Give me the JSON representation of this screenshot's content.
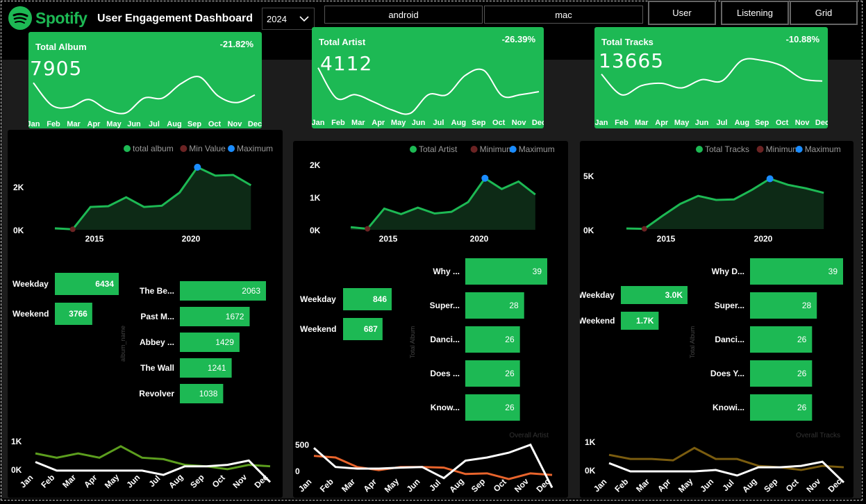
{
  "header": {
    "logo_text": "Spotify",
    "title": "User Engagement Dashboard",
    "year": "2024",
    "platforms": [
      "android",
      "mac"
    ],
    "nav": [
      "User",
      "Listening",
      "Grid"
    ]
  },
  "colors": {
    "brand": "#1DB954",
    "min": "#6b2323",
    "max": "#1a8cff"
  },
  "months": [
    "Jan",
    "Feb",
    "Mar",
    "Apr",
    "May",
    "Jun",
    "Jul",
    "Aug",
    "Sep",
    "Oct",
    "Nov",
    "Dec"
  ],
  "kpis": [
    {
      "label": "Total Album",
      "value": "7905",
      "pct": "-21.82%",
      "trend": [
        0.72,
        0.22,
        0.18,
        0.35,
        0.12,
        0.05,
        0.38,
        0.38,
        0.7,
        0.85,
        0.43,
        0.28,
        0.45
      ]
    },
    {
      "label": "Total Artist",
      "value": "4112",
      "pct": "-26.39%",
      "trend": [
        0.95,
        0.35,
        0.42,
        0.28,
        0.12,
        0.05,
        0.42,
        0.42,
        0.8,
        0.9,
        0.4,
        0.42,
        0.48
      ]
    },
    {
      "label": "Total Tracks",
      "value": "13665",
      "pct": "-10.88%",
      "trend": [
        0.7,
        0.25,
        0.45,
        0.5,
        0.4,
        0.58,
        0.55,
        1.0,
        1.0,
        0.88,
        0.6,
        0.55
      ]
    }
  ],
  "panels": [
    {
      "legend": [
        "total album",
        "Min Value",
        "Maximum"
      ],
      "chart_data": {
        "type": "area",
        "x": [
          2012,
          2013,
          2014,
          2015,
          2016,
          2017,
          2018,
          2019,
          2020,
          2021,
          2022,
          2023,
          2024
        ],
        "y": [
          60,
          20,
          950,
          980,
          1350,
          950,
          1000,
          1550,
          2600,
          2250,
          2280,
          1850,
          0
        ],
        "yticks": [
          "0K",
          "2K"
        ],
        "ymax": 3000,
        "xticks": [
          "2015",
          "2020"
        ],
        "min_index": 1,
        "max_index": 8
      },
      "daytype": [
        {
          "label": "Weekday",
          "value": "6434",
          "v": 6434
        },
        {
          "label": "Weekend",
          "value": "3766",
          "v": 3766
        }
      ],
      "bar_axis": "album_name",
      "bars": [
        {
          "label": "The Be...",
          "value": "2063",
          "v": 2063
        },
        {
          "label": "Past M...",
          "value": "1672",
          "v": 1672
        },
        {
          "label": "Abbey ...",
          "value": "1429",
          "v": 1429
        },
        {
          "label": "The Wall",
          "value": "1241",
          "v": 1241
        },
        {
          "label": "Revolver",
          "value": "1038",
          "v": 1038
        }
      ],
      "overall_label": "",
      "bottom": {
        "type": "line",
        "yticks": [
          "1K",
          "0K"
        ],
        "series1_color": "#5c9e1e",
        "series2_color": "#ffffff",
        "series1": [
          0.7,
          0.55,
          0.7,
          0.55,
          0.95,
          0.55,
          0.5,
          0.3,
          0.25,
          0.15,
          0.3,
          0.25
        ],
        "series2": [
          0.4,
          0.1,
          0.1,
          0.1,
          0.1,
          0.1,
          -0.05,
          0.25,
          0.25,
          0.3,
          0.45,
          -0.3
        ]
      }
    },
    {
      "legend": [
        "Total Artist",
        "Minimum",
        "Maximum"
      ],
      "chart_data": {
        "type": "area",
        "x": [
          2012,
          2013,
          2014,
          2015,
          2016,
          2017,
          2018,
          2019,
          2020,
          2021,
          2022,
          2023,
          2024
        ],
        "y": [
          80,
          30,
          650,
          480,
          680,
          500,
          550,
          850,
          1580,
          1250,
          1480,
          1080,
          0
        ],
        "yticks": [
          "0K",
          "1K",
          "2K"
        ],
        "ymax": 2000,
        "xticks": [
          "2015",
          "2020"
        ],
        "min_index": 1,
        "max_index": 8
      },
      "daytype": [
        {
          "label": "Weekday",
          "value": "846",
          "v": 846
        },
        {
          "label": "Weekend",
          "value": "687",
          "v": 687
        }
      ],
      "bar_axis": "Total Album",
      "bars": [
        {
          "label": "Why ...",
          "value": "39",
          "v": 39
        },
        {
          "label": "Super...",
          "value": "28",
          "v": 28
        },
        {
          "label": "Danci...",
          "value": "26",
          "v": 26
        },
        {
          "label": "Does ...",
          "value": "26",
          "v": 26
        },
        {
          "label": "Know...",
          "value": "26",
          "v": 26
        }
      ],
      "overall_label": "Overall Artist",
      "bottom": {
        "type": "line",
        "yticks": [
          "500",
          "0"
        ],
        "series1_color": "#e8642c",
        "series2_color": "#ffffff",
        "series1": [
          0.75,
          0.7,
          0.4,
          0.3,
          0.4,
          0.4,
          0.38,
          0.18,
          0.2,
          0.02,
          0.2,
          0.15
        ],
        "series2": [
          1.0,
          0.4,
          0.35,
          0.35,
          0.38,
          0.4,
          0.05,
          0.6,
          0.7,
          0.85,
          1.1,
          -0.25
        ]
      }
    },
    {
      "legend": [
        "Total Tracks",
        "Minimum",
        "Maximum"
      ],
      "chart_data": {
        "type": "area",
        "x": [
          2012,
          2013,
          2014,
          2015,
          2016,
          2017,
          2018,
          2019,
          2020,
          2021,
          2022,
          2023,
          2024
        ],
        "y": [
          60,
          30,
          1300,
          2500,
          3300,
          2900,
          2950,
          3900,
          5000,
          4400,
          4050,
          3600,
          0
        ],
        "yticks": [
          "0K",
          "5K"
        ],
        "ymax": 6000,
        "xticks": [
          "2015",
          "2020"
        ],
        "min_index": 1,
        "max_index": 8
      },
      "daytype": [
        {
          "label": "Weekday",
          "value": "3.0K",
          "v": 3000
        },
        {
          "label": "Weekend",
          "value": "1.7K",
          "v": 1700
        }
      ],
      "bar_axis": "Total Album",
      "bars": [
        {
          "label": "Why D...",
          "value": "39",
          "v": 39
        },
        {
          "label": "Super...",
          "value": "28",
          "v": 28
        },
        {
          "label": "Danci...",
          "value": "26",
          "v": 26
        },
        {
          "label": "Does Y...",
          "value": "26",
          "v": 26
        },
        {
          "label": "Knowi...",
          "value": "26",
          "v": 26
        }
      ],
      "overall_label": "Overall Tracks",
      "bottom": {
        "type": "line",
        "yticks": [
          "1K",
          "0K"
        ],
        "series1_color": "#7a5c0f",
        "series2_color": "#ffffff",
        "series1": [
          0.7,
          0.55,
          0.55,
          0.5,
          0.95,
          0.55,
          0.55,
          0.3,
          0.25,
          0.15,
          0.3,
          0.25
        ],
        "series2": [
          0.4,
          0.1,
          0.1,
          0.1,
          0.1,
          0.15,
          -0.05,
          0.25,
          0.25,
          0.3,
          0.45,
          -0.3
        ]
      }
    }
  ]
}
